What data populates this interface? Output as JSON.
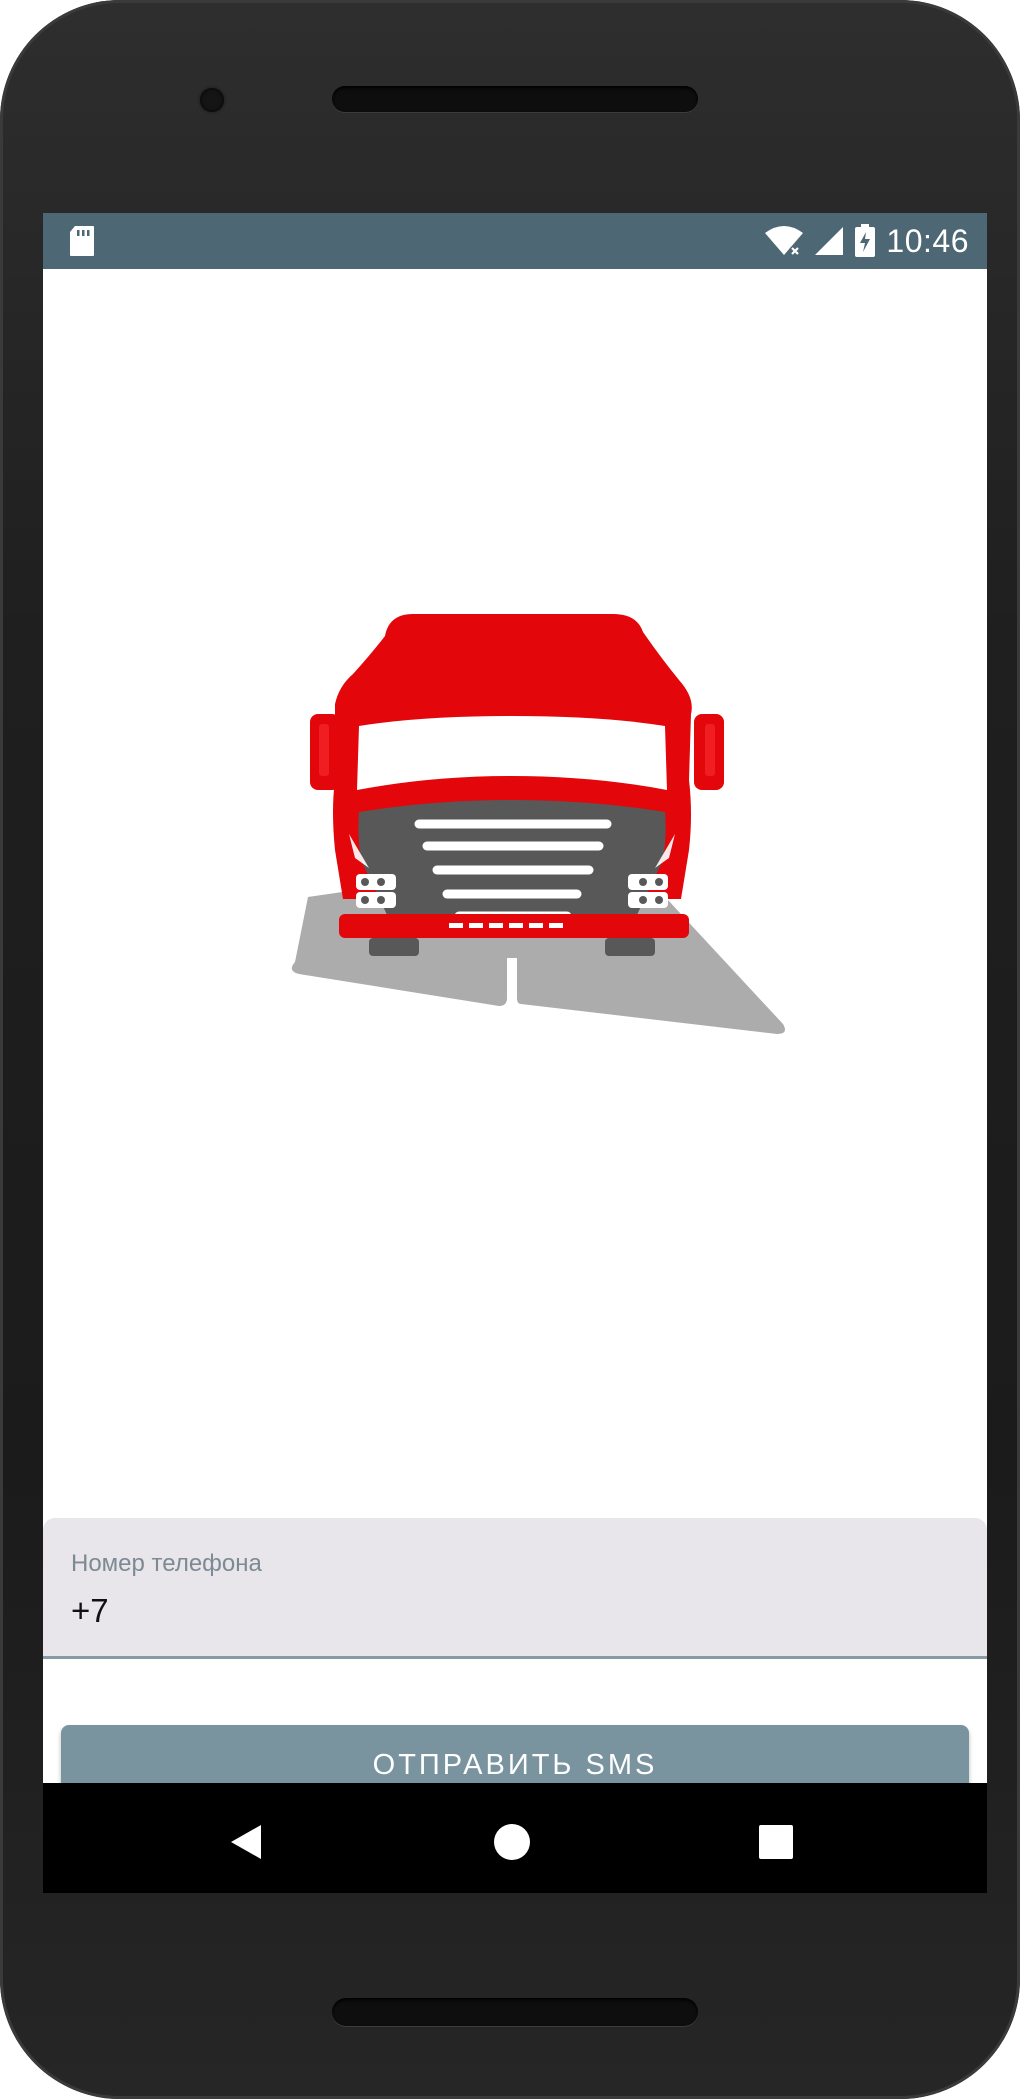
{
  "statusbar": {
    "time": "10:46",
    "icons": [
      "sd-card-icon",
      "wifi-icon",
      "signal-icon",
      "battery-charging-icon"
    ]
  },
  "login": {
    "phone_label": "Номер телефона",
    "phone_value": "+7",
    "send_button": "ОТПРАВИТЬ SMS"
  },
  "navbar": {
    "icons": [
      "back-icon",
      "home-icon",
      "recents-icon"
    ]
  },
  "colors": {
    "statusbar": "#4e6775",
    "truck_red": "#e3060a",
    "grille": "#585858",
    "road": "#acacac",
    "button": "#7a949f",
    "field_bg": "#e8e6ea"
  }
}
